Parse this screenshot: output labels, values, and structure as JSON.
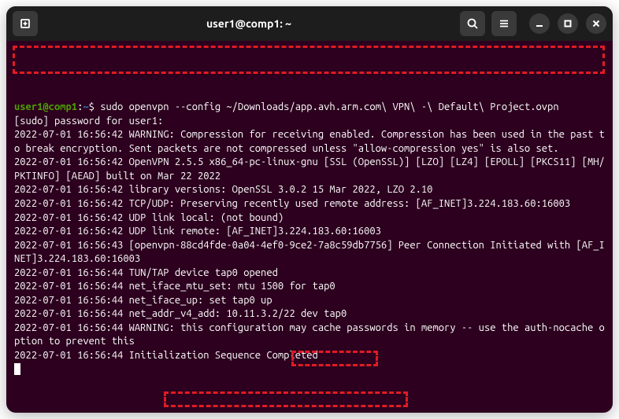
{
  "titlebar": {
    "title": "user1@comp1: ~"
  },
  "prompt": {
    "user_host": "user1@comp1",
    "path": "~",
    "command": "sudo openvpn --config ~/Downloads/app.avh.arm.com\\ VPN\\ -\\ Default\\ Project.ovpn"
  },
  "lines": {
    "l0": "[sudo] password for user1:",
    "l1": "2022-07-01 16:56:42 WARNING: Compression for receiving enabled. Compression has been used in the past to break encryption. Sent packets are not compressed unless \"allow-compression yes\" is also set.",
    "l2": "2022-07-01 16:56:42 OpenVPN 2.5.5 x86_64-pc-linux-gnu [SSL (OpenSSL)] [LZO] [LZ4] [EPOLL] [PKCS11] [MH/PKTINFO] [AEAD] built on Mar 22 2022",
    "l3": "2022-07-01 16:56:42 library versions: OpenSSL 3.0.2 15 Mar 2022, LZO 2.10",
    "l4": "2022-07-01 16:56:42 TCP/UDP: Preserving recently used remote address: [AF_INET]3.224.183.60:16003",
    "l5": "2022-07-01 16:56:42 UDP link local: (not bound)",
    "l6": "2022-07-01 16:56:42 UDP link remote: [AF_INET]3.224.183.60:16003",
    "l7": "2022-07-01 16:56:43 [openvpn-88cd4fde-0a04-4ef0-9ce2-7a8c59db7756] Peer Connection Initiated with [AF_INET]3.224.183.60:16003",
    "l8": "2022-07-01 16:56:44 TUN/TAP device tap0 opened",
    "l9": "2022-07-01 16:56:44 net_iface_mtu_set: mtu 1500 for tap0",
    "l10": "2022-07-01 16:56:44 net_iface_up: set tap0 up",
    "l11": "2022-07-01 16:56:44 net_addr_v4_add: 10.11.3.2/22 dev tap0",
    "l12": "2022-07-01 16:56:44 WARNING: this configuration may cache passwords in memory -- use the auth-nocache option to prevent this",
    "l13": "2022-07-01 16:56:44 Initialization Sequence Completed"
  },
  "highlights": {
    "ip": "10.11.3.2/22",
    "init": "Initialization Sequence Completed"
  }
}
